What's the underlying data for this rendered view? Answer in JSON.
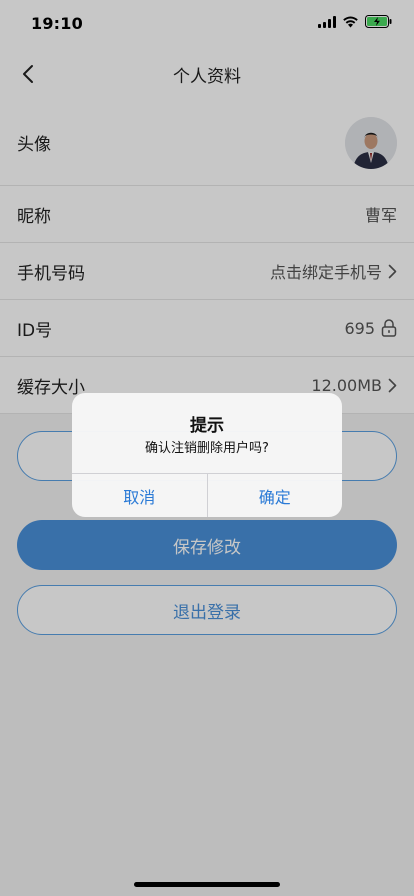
{
  "status_bar": {
    "time": "19:10"
  },
  "nav": {
    "title": "个人资料"
  },
  "profile": {
    "rows": [
      {
        "label": "头像"
      },
      {
        "label": "昵称",
        "value": "曹军"
      },
      {
        "label": "手机号码",
        "value": "点击绑定手机号"
      },
      {
        "label": "ID号",
        "value": "695"
      },
      {
        "label": "缓存大小",
        "value": "12.00MB"
      }
    ]
  },
  "buttons": {
    "save": "保存修改",
    "logout": "退出登录"
  },
  "dialog": {
    "title": "提示",
    "message": "确认注销删除用户吗?",
    "cancel": "取消",
    "confirm": "确定"
  },
  "colors": {
    "accent": "#4a90d9",
    "dialog_button": "#2a7ad6",
    "battery": "#4cd964"
  },
  "icons": [
    "back-icon",
    "chevron-right-icon",
    "lock-icon",
    "signal-icon",
    "wifi-icon",
    "battery-charging-icon"
  ]
}
